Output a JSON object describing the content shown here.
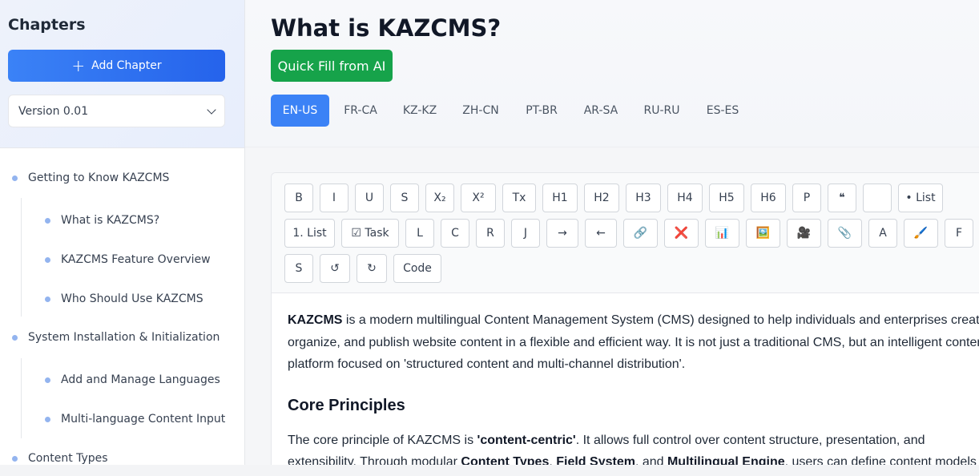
{
  "sidebar": {
    "title": "Chapters",
    "add_button": "Add Chapter",
    "version": "Version 0.01",
    "tree": [
      {
        "label": "Getting to Know KAZCMS",
        "level": 0
      },
      {
        "label": "What is KAZCMS?",
        "level": 1
      },
      {
        "label": "KAZCMS Feature Overview",
        "level": 1
      },
      {
        "label": "Who Should Use KAZCMS",
        "level": 1
      },
      {
        "label": "System Installation & Initialization",
        "level": 0
      },
      {
        "label": "Add and Manage Languages",
        "level": 1
      },
      {
        "label": "Multi-language Content Input",
        "level": 1
      },
      {
        "label": "Content Types",
        "level": 0
      }
    ]
  },
  "main": {
    "title": "What is KAZCMS?",
    "ai_button": "Quick Fill from AI",
    "languages": [
      "EN-US",
      "FR-CA",
      "KZ-KZ",
      "ZH-CN",
      "PT-BR",
      "AR-SA",
      "RU-RU",
      "ES-ES"
    ],
    "active_language": "EN-US"
  },
  "toolbar": {
    "row1": [
      "B",
      "I",
      "U",
      "S",
      "X₂",
      "X²",
      "Tx",
      "H1",
      "H2",
      "H3",
      "H4",
      "H5",
      "H6",
      "P",
      "❝",
      "",
      "• List"
    ],
    "row2": [
      "1. List",
      "☑ Task",
      "L",
      "C",
      "R",
      "J",
      "→",
      "←",
      "🔗",
      "❌",
      "📊",
      "🖼️",
      "🎥",
      "📎",
      "A",
      "🖌️",
      "F"
    ],
    "row3": [
      "S",
      "↺",
      "↻",
      "Code"
    ]
  },
  "content": {
    "p1_bold": "KAZCMS",
    "p1_rest": " is a modern multilingual Content Management System (CMS) designed to help individuals and enterprises create, organize, and publish website content in a flexible and efficient way. It is not just a traditional CMS, but an intelligent content platform focused on 'structured content and multi-channel distribution'.",
    "heading": "Core Principles",
    "p2_a": "The core principle of KAZCMS is ",
    "p2_b": "'content-centric'",
    "p2_c": ". It allows full control over content structure, presentation, and extensibility. Through modular ",
    "p2_d": "Content Types",
    "p2_e": ", ",
    "p2_f": "Field System",
    "p2_g": ", and ",
    "p2_h": "Multilingual Engine",
    "p2_i": ", users can define content models"
  }
}
